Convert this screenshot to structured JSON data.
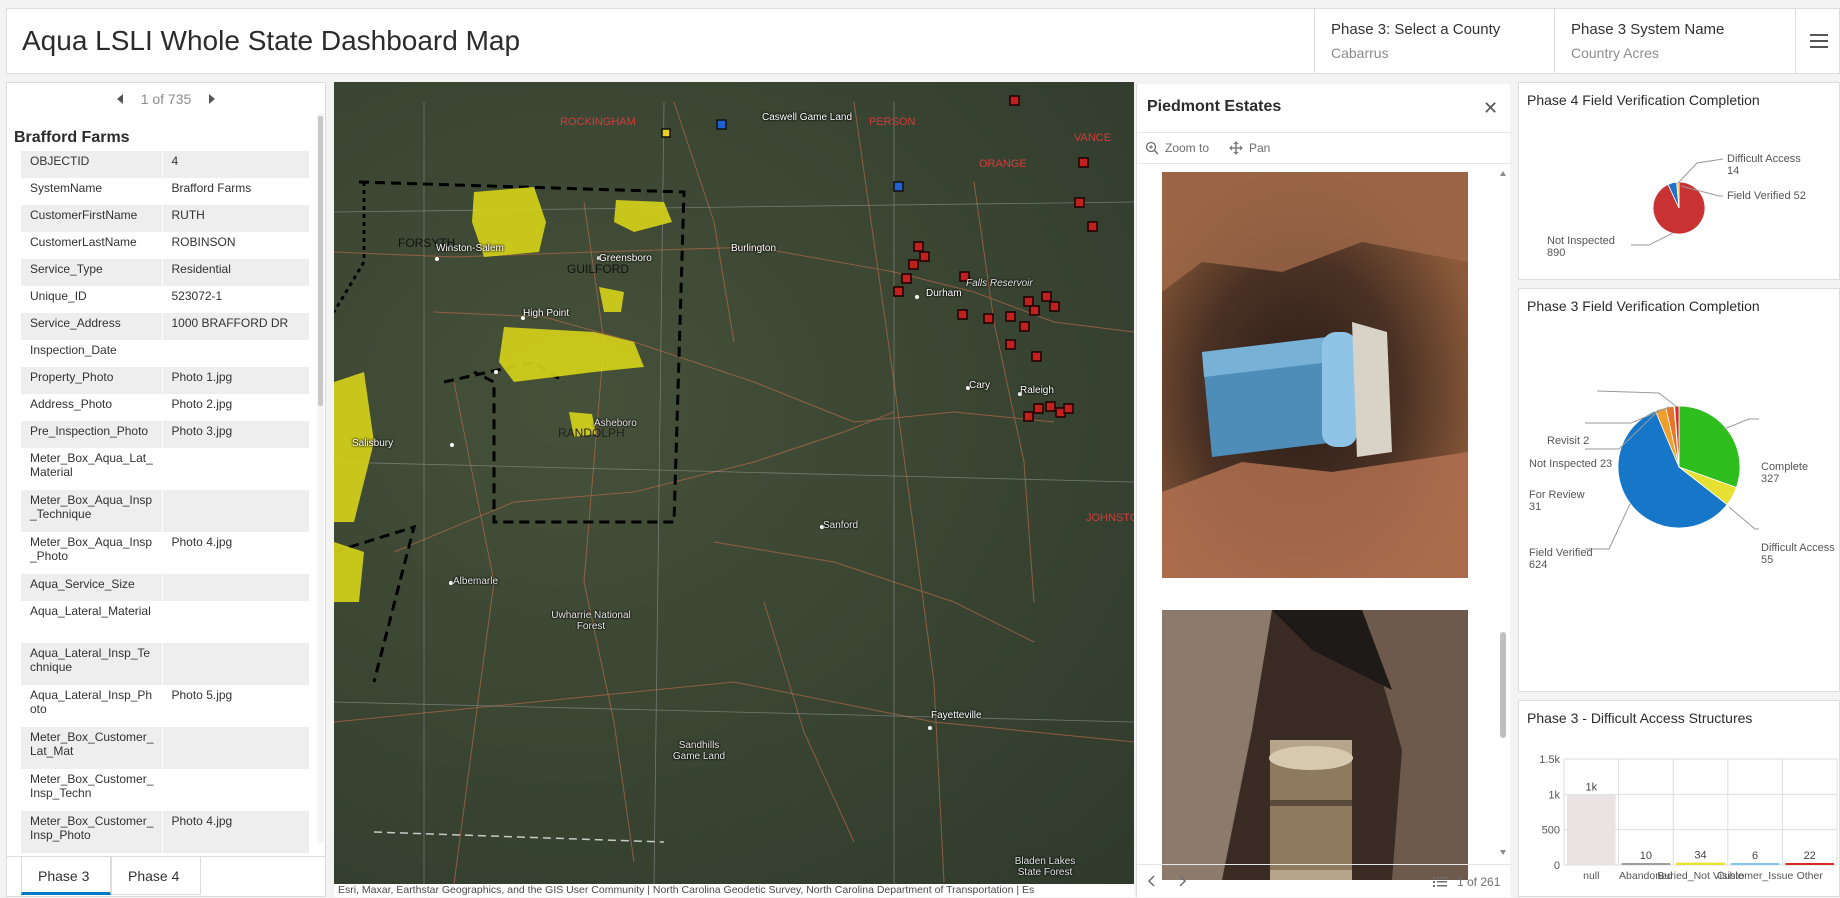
{
  "header": {
    "title": "Aqua LSLI Whole State Dashboard Map",
    "selectors": [
      {
        "label": "Phase 3: Select a County",
        "value": "Cabarrus"
      },
      {
        "label": "Phase 3 System Name",
        "value": "Country Acres"
      }
    ],
    "menu_icon": "hamburger-menu-icon"
  },
  "details": {
    "pager": "1 of 735",
    "record_title": "Brafford Farms",
    "attributes": [
      {
        "key": "OBJECTID",
        "value": "4"
      },
      {
        "key": "SystemName",
        "value": "Brafford Farms"
      },
      {
        "key": "CustomerFirstName",
        "value": "RUTH"
      },
      {
        "key": "CustomerLastName",
        "value": "ROBINSON"
      },
      {
        "key": "Service_Type",
        "value": "Residential"
      },
      {
        "key": "Unique_ID",
        "value": "523072-1"
      },
      {
        "key": "Service_Address",
        "value": "1000 BRAFFORD DR"
      },
      {
        "key": "Inspection_Date",
        "value": ""
      },
      {
        "key": "Property_Photo",
        "value": "Photo 1.jpg"
      },
      {
        "key": "Address_Photo",
        "value": "Photo 2.jpg"
      },
      {
        "key": "Pre_Inspection_Photo",
        "value": "Photo 3.jpg"
      },
      {
        "key": "Meter_Box_Aqua_Lat_Material",
        "value": ""
      },
      {
        "key": "Meter_Box_Aqua_Insp_Technique",
        "value": ""
      },
      {
        "key": "Meter_Box_Aqua_Insp_Photo",
        "value": "Photo 4.jpg"
      },
      {
        "key": "Aqua_Service_Size",
        "value": ""
      },
      {
        "key": "Aqua_Lateral_Material",
        "value": ""
      },
      {
        "key": "Aqua_Lateral_Insp_Technique",
        "value": ""
      },
      {
        "key": "Aqua_Lateral_Insp_Photo",
        "value": "Photo 5.jpg"
      },
      {
        "key": "Meter_Box_Customer_Lat_Mat",
        "value": ""
      },
      {
        "key": "Meter_Box_Customer_Insp_Techn",
        "value": ""
      },
      {
        "key": "Meter_Box_Customer_Insp_Photo",
        "value": "Photo 4.jpg"
      }
    ],
    "tabs": [
      "Phase 3",
      "Phase 4"
    ]
  },
  "map": {
    "places": [
      "Caswell Game Land",
      "Winston-Salem",
      "Greensboro",
      "Burlington",
      "High Point",
      "Durham",
      "Falls Reservoir",
      "Cary",
      "Raleigh",
      "Asheboro",
      "Salisbury",
      "Sanford",
      "Albemarle",
      "Uwharrie National Forest",
      "Fayetteville",
      "Sandhills Game Land",
      "Bladen Lakes State Forest"
    ],
    "county_labels": [
      "FORSYTH",
      "GUILFORD",
      "RANDOLPH",
      "ROCKINGHAM",
      "PERSON",
      "ORANGE",
      "VANCE",
      "JOHNSTON"
    ],
    "attribution": "Esri, Maxar, Earthstar Geographics, and the GIS User Community | North Carolina Geodetic Survey, North Carolina Department of Transportation | Es"
  },
  "popup": {
    "title": "Piedmont Estates",
    "zoom_label": "Zoom to",
    "pan_label": "Pan",
    "counter": "1 of 261"
  },
  "phase4_chart": {
    "title": "Phase 4 Field Verification Completion",
    "chart_data": {
      "type": "pie",
      "slices": [
        {
          "label": "Not Inspected",
          "value": 890,
          "color": "#c83232"
        },
        {
          "label": "Field Verified",
          "value": 52,
          "color": "#1a75c6"
        },
        {
          "label": "Difficult Access",
          "value": 14,
          "color": "#f2b928"
        }
      ]
    }
  },
  "phase3_chart": {
    "title": "Phase 3 Field Verification Completion",
    "chart_data": {
      "type": "pie",
      "slices": [
        {
          "label": "Complete",
          "value": 327,
          "color": "#2dbe1d"
        },
        {
          "label": "Difficult Access",
          "value": 55,
          "color": "#e6e032"
        },
        {
          "label": "Field Verified",
          "value": 624,
          "color": "#1677c9"
        },
        {
          "label": "For Review",
          "value": 31,
          "color": "#f0a02a"
        },
        {
          "label": "Not Inspected",
          "value": 23,
          "color": "#e8742a"
        },
        {
          "label": "Revisit",
          "value": 2,
          "color": "#8a2be2"
        },
        {
          "label": "",
          "value": 12,
          "color": "#d62a2a"
        }
      ]
    }
  },
  "phase3_bar": {
    "title": "Phase 3 - Difficult Access Structures",
    "chart_data": {
      "type": "bar",
      "categories": [
        "null",
        "Abandoned",
        "Buried_No",
        "Customer_Issue",
        "Other"
      ],
      "visible_category_labels": [
        "null",
        "Abandoned",
        "Buried_Not Visible",
        "Customer_Issue",
        "Other"
      ],
      "values": [
        1000,
        10,
        34,
        6,
        22
      ],
      "value_labels": [
        "1k",
        "10",
        "34",
        "6",
        "22"
      ],
      "colors": [
        "#e9e3e3",
        "#9e9e9e",
        "#e8e232",
        "#7fc8f0",
        "#d62a2a"
      ],
      "ylim": [
        0,
        1500
      ],
      "yticks": [
        "1.5k",
        "1k",
        "500",
        "0"
      ]
    }
  }
}
